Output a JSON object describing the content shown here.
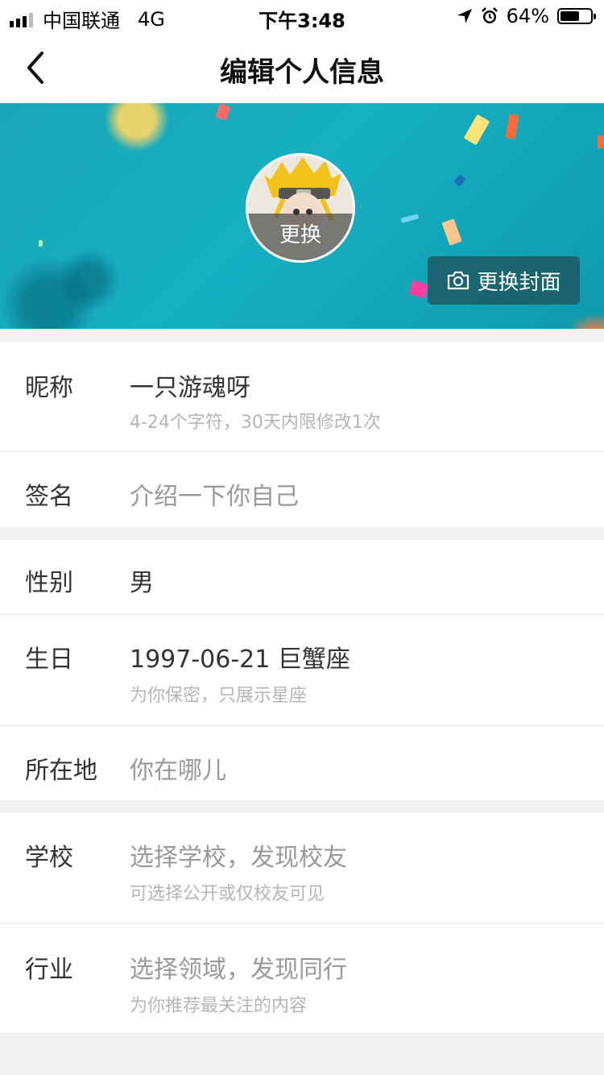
{
  "status_bar": {
    "carrier": "中国联通",
    "network": "4G",
    "time": "下午3:48",
    "battery": "64%",
    "battery_level": 0.64,
    "signal_bars": 3
  },
  "nav": {
    "title": "编辑个人信息",
    "back_icon": "chevron-left-icon"
  },
  "cover": {
    "avatar_overlay": "更换",
    "change_cover_label": "更换封面",
    "change_cover_icon": "camera-icon"
  },
  "fields": {
    "nickname": {
      "label": "昵称",
      "value": "一只游魂呀",
      "hint": "4-24个字符，30天内限修改1次"
    },
    "signature": {
      "label": "签名",
      "placeholder": "介绍一下你自己"
    },
    "gender": {
      "label": "性别",
      "value": "男"
    },
    "birthday": {
      "label": "生日",
      "value": "1997-06-21 巨蟹座",
      "hint": "为你保密，只展示星座"
    },
    "location": {
      "label": "所在地",
      "placeholder": "你在哪儿"
    },
    "school": {
      "label": "学校",
      "placeholder": "选择学校，发现校友",
      "hint": "可选择公开或仅校友可见"
    },
    "industry": {
      "label": "行业",
      "placeholder": "选择领域，发现同行",
      "hint": "为你推荐最关注的内容"
    }
  },
  "colors": {
    "cover_teal": "#16b0c3",
    "background": "#f0f1f3",
    "placeholder": "#999999",
    "hint": "#b5b5b5"
  }
}
